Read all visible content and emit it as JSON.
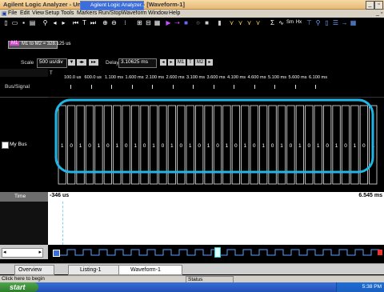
{
  "window": {
    "title": "Agilent Logic Analyzer - Unnamed Configuration - [Waveform-1]"
  },
  "menu": [
    "File",
    "Edit",
    "View",
    "Setup",
    "Tools",
    "Markers",
    "Run/Stop",
    "Waveform",
    "Window",
    "Help"
  ],
  "marker_readout": "M1 to M2 = 328.125 us",
  "scale": {
    "label": "Scale",
    "value": "500 us/div",
    "delay_label": "Delay",
    "delay_value": "3.10625 ms"
  },
  "ruler_ticks": [
    "100.0 us",
    "600.0 us",
    "1.100 ms",
    "1.600 ms",
    "2.100 ms",
    "2.600 ms",
    "3.100 ms",
    "3.600 ms",
    "4.100 ms",
    "4.600 ms",
    "5.100 ms",
    "5.600 ms",
    "6.100 ms"
  ],
  "left": {
    "bus_signal_header": "Bus/Signal",
    "bus_name": "My Bus",
    "time_label": "Time"
  },
  "bus_bits": [
    "1",
    "0",
    "1",
    "0",
    "1",
    "0",
    "1",
    "0",
    "1",
    "0",
    "1",
    "0",
    "1",
    "0",
    "1",
    "0",
    "1",
    "0",
    "1",
    "0",
    "1",
    "0",
    "1",
    "0",
    "1",
    "0",
    "1",
    "0",
    "1",
    "0",
    "1",
    "0",
    "1",
    "0",
    "1"
  ],
  "timeline": {
    "start": "-346 us",
    "end": "6.545 ms"
  },
  "tabs": [
    "Overview",
    "Listing-1",
    "Waveform-1"
  ],
  "status": {
    "left": "Click here to begin",
    "mid": "Status"
  },
  "taskbar": {
    "start": "start",
    "app": "Agilent Logic Analyzer...",
    "clock": "5:38 PM"
  }
}
